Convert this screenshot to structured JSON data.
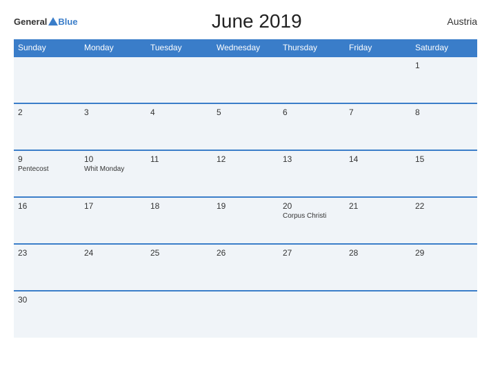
{
  "header": {
    "logo_general": "General",
    "logo_blue": "Blue",
    "title": "June 2019",
    "country": "Austria"
  },
  "weekdays": [
    "Sunday",
    "Monday",
    "Tuesday",
    "Wednesday",
    "Thursday",
    "Friday",
    "Saturday"
  ],
  "weeks": [
    [
      {
        "day": "",
        "holiday": ""
      },
      {
        "day": "",
        "holiday": ""
      },
      {
        "day": "",
        "holiday": ""
      },
      {
        "day": "",
        "holiday": ""
      },
      {
        "day": "",
        "holiday": ""
      },
      {
        "day": "",
        "holiday": ""
      },
      {
        "day": "1",
        "holiday": ""
      }
    ],
    [
      {
        "day": "2",
        "holiday": ""
      },
      {
        "day": "3",
        "holiday": ""
      },
      {
        "day": "4",
        "holiday": ""
      },
      {
        "day": "5",
        "holiday": ""
      },
      {
        "day": "6",
        "holiday": ""
      },
      {
        "day": "7",
        "holiday": ""
      },
      {
        "day": "8",
        "holiday": ""
      }
    ],
    [
      {
        "day": "9",
        "holiday": "Pentecost"
      },
      {
        "day": "10",
        "holiday": "Whit Monday"
      },
      {
        "day": "11",
        "holiday": ""
      },
      {
        "day": "12",
        "holiday": ""
      },
      {
        "day": "13",
        "holiday": ""
      },
      {
        "day": "14",
        "holiday": ""
      },
      {
        "day": "15",
        "holiday": ""
      }
    ],
    [
      {
        "day": "16",
        "holiday": ""
      },
      {
        "day": "17",
        "holiday": ""
      },
      {
        "day": "18",
        "holiday": ""
      },
      {
        "day": "19",
        "holiday": ""
      },
      {
        "day": "20",
        "holiday": "Corpus Christi"
      },
      {
        "day": "21",
        "holiday": ""
      },
      {
        "day": "22",
        "holiday": ""
      }
    ],
    [
      {
        "day": "23",
        "holiday": ""
      },
      {
        "day": "24",
        "holiday": ""
      },
      {
        "day": "25",
        "holiday": ""
      },
      {
        "day": "26",
        "holiday": ""
      },
      {
        "day": "27",
        "holiday": ""
      },
      {
        "day": "28",
        "holiday": ""
      },
      {
        "day": "29",
        "holiday": ""
      }
    ],
    [
      {
        "day": "30",
        "holiday": ""
      },
      {
        "day": "",
        "holiday": ""
      },
      {
        "day": "",
        "holiday": ""
      },
      {
        "day": "",
        "holiday": ""
      },
      {
        "day": "",
        "holiday": ""
      },
      {
        "day": "",
        "holiday": ""
      },
      {
        "day": "",
        "holiday": ""
      }
    ]
  ]
}
